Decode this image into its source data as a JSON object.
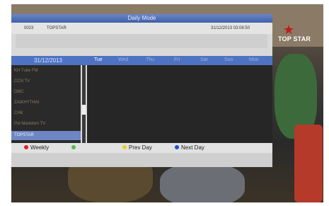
{
  "app_title": "Daily Mode",
  "info": {
    "channel_number": "0023",
    "channel_name": "TOPSTAR",
    "datetime": "31/12/2013  03:08:50"
  },
  "date_header": {
    "date": "31/12/2013",
    "days": [
      "Tue",
      "Wed",
      "Thu",
      "Fri",
      "Sat",
      "Sun",
      "Mon"
    ],
    "active_day_index": 0
  },
  "channels": [
    "KH Tube FM",
    "CCN TV",
    "DMC",
    "ZAIKHYTHAI",
    "CH8",
    "Pol Manidom TV",
    "TOPSTAR"
  ],
  "selected_channel_index": 6,
  "legend": [
    {
      "label": "Weekly",
      "color": "#e02020",
      "enabled": true
    },
    {
      "label": "",
      "color": "#4fbf40",
      "enabled": false
    },
    {
      "label": "Prev Day",
      "color": "#e8d020",
      "enabled": true
    },
    {
      "label": "Next Day",
      "color": "#2050d0",
      "enabled": true
    }
  ],
  "logo_text": "TOP STAR"
}
